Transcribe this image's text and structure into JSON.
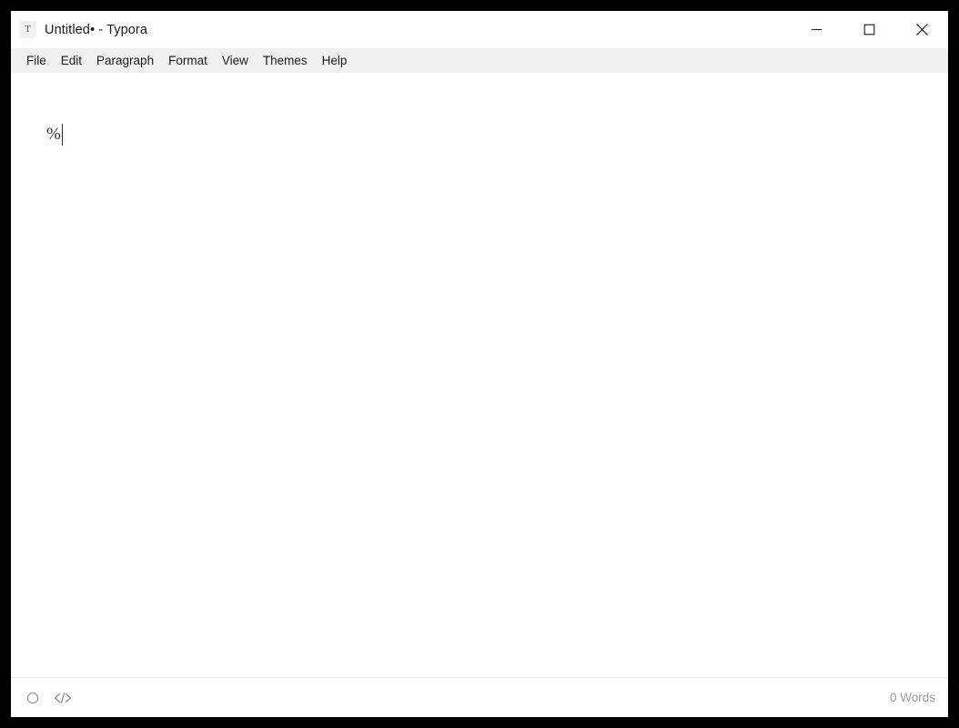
{
  "window": {
    "app_icon_letter": "T",
    "title": "Untitled• - Typora",
    "controls": {
      "minimize_label": "Minimize",
      "maximize_label": "Maximize",
      "close_label": "Close"
    },
    "frame_color": "#000000",
    "titlebar_color": "#ffffff"
  },
  "menubar": {
    "background_color": "#f0f0f0",
    "items": [
      {
        "label": "File"
      },
      {
        "label": "Edit"
      },
      {
        "label": "Paragraph"
      },
      {
        "label": "Format"
      },
      {
        "label": "View"
      },
      {
        "label": "Themes"
      },
      {
        "label": "Help"
      }
    ]
  },
  "editor": {
    "background_color": "#ffffff",
    "text_color": "#333333",
    "content": "%",
    "caret_visible": true
  },
  "statusbar": {
    "background_color": "#ffffff",
    "focus_mode_icon": "circle-icon",
    "source_code_icon": "source-code-icon",
    "source_code_glyph": "</>",
    "word_count": "0 Words",
    "word_count_color": "#9b9b9b"
  }
}
